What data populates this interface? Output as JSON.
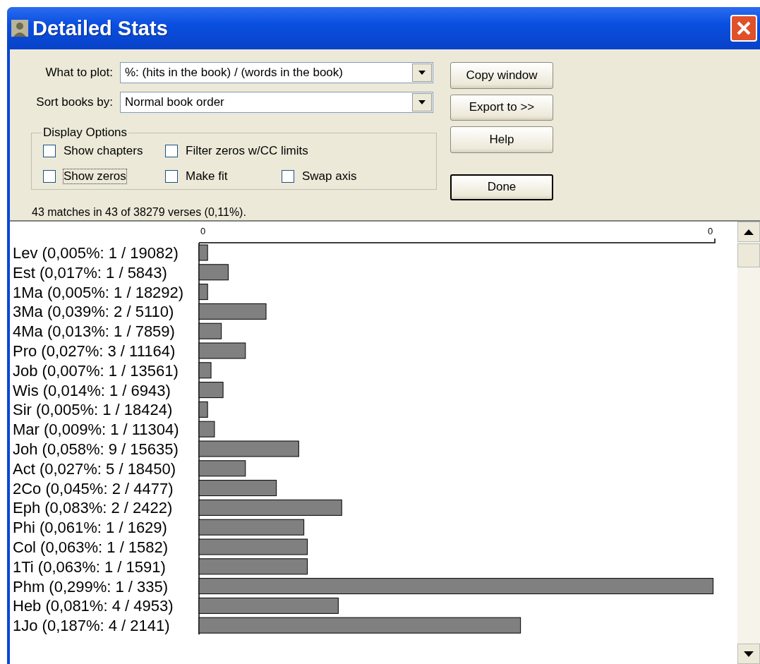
{
  "window": {
    "title": "Detailed Stats"
  },
  "fields": [
    {
      "label": "What to plot:",
      "value": "%: (hits in the book) / (words in the book)"
    },
    {
      "label": "Sort books by:",
      "value": "Normal book order"
    }
  ],
  "display_options": {
    "title": "Display Options",
    "rows": [
      [
        {
          "label": "Show chapters",
          "checked": false,
          "focused": false
        },
        {
          "label": "Filter zeros w/CC limits",
          "checked": false,
          "focused": false
        }
      ],
      [
        {
          "label": "Show zeros",
          "checked": false,
          "focused": true
        },
        {
          "label": "Make fit",
          "checked": false,
          "focused": false
        },
        {
          "label": "Swap axis",
          "checked": false,
          "focused": false
        }
      ]
    ]
  },
  "buttons": [
    {
      "label": "Copy window",
      "default": false
    },
    {
      "label": "Export to >>",
      "default": false
    },
    {
      "label": "Help",
      "default": false
    },
    {
      "label": "Done",
      "default": true
    }
  ],
  "status": "43 matches in 43 of 38279 verses (0,11%).",
  "chart": {
    "chart_data": {
      "type": "bar",
      "orientation": "horizontal",
      "categories": [
        "Lev (0,005%: 1 / 19082)",
        "Est (0,017%: 1 / 5843)",
        "1Ma (0,005%: 1 / 18292)",
        "3Ma (0,039%: 2 / 5110)",
        "4Ma (0,013%: 1 / 7859)",
        "Pro (0,027%: 3 / 11164)",
        "Job (0,007%: 1 / 13561)",
        "Wis (0,014%: 1 / 6943)",
        "Sir (0,005%: 1 / 18424)",
        "Mar (0,009%: 1 / 11304)",
        "Joh (0,058%: 9 / 15635)",
        "Act (0,027%: 5 / 18450)",
        "2Co (0,045%: 2 / 4477)",
        "Eph (0,083%: 2 / 2422)",
        "Phi (0,061%: 1 / 1629)",
        "Col (0,063%: 1 / 1582)",
        "1Ti (0,063%: 1 / 1591)",
        "Phm (0,299%: 1 / 335)",
        "Heb (0,081%: 4 / 4953)",
        "1Jo (0,187%: 4 / 2141)"
      ],
      "values": [
        0.005,
        0.017,
        0.005,
        0.039,
        0.013,
        0.027,
        0.007,
        0.014,
        0.005,
        0.009,
        0.058,
        0.027,
        0.045,
        0.083,
        0.061,
        0.063,
        0.063,
        0.299,
        0.081,
        0.187
      ],
      "xlim": [
        0,
        0.3
      ],
      "xticks": [
        {
          "value": 0,
          "label": "0"
        },
        {
          "value": 0.3,
          "label": "0"
        }
      ]
    }
  }
}
